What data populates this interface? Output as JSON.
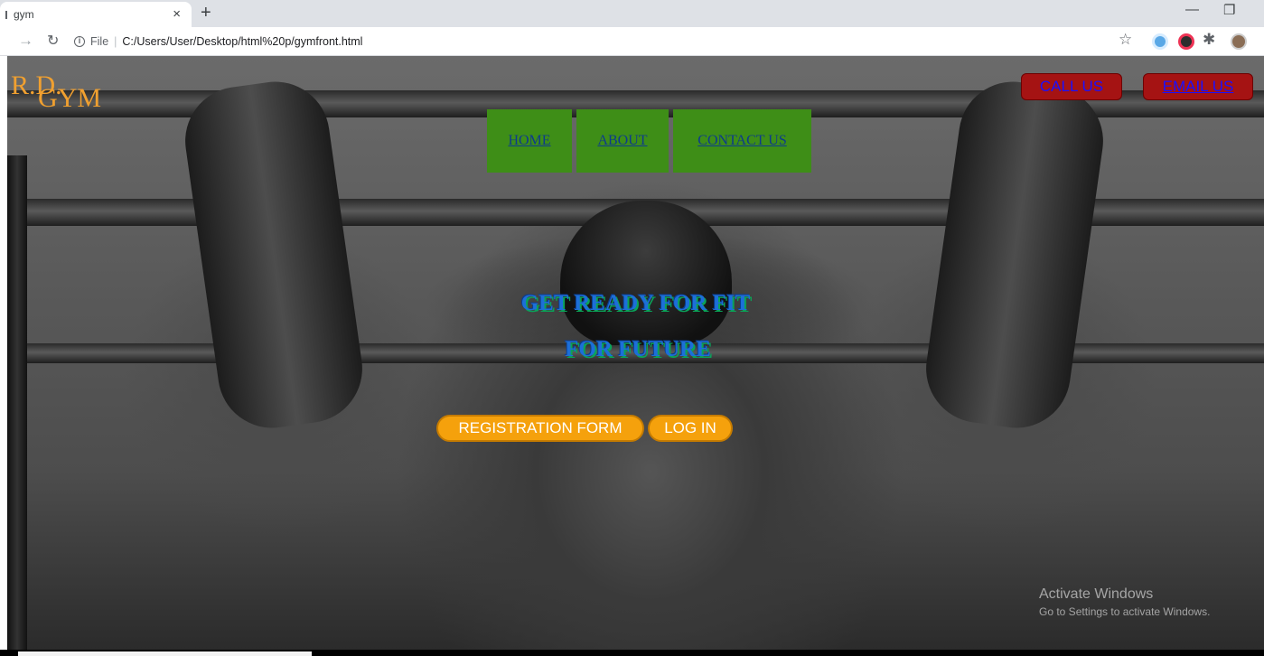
{
  "browser": {
    "tab_title": "gym",
    "url_scheme": "File",
    "url_path": "C:/Users/User/Desktop/html%20p/gymfront.html"
  },
  "logo": {
    "line1": "R.D.",
    "line2": "GYM",
    "color": "#f0a030"
  },
  "header_buttons": {
    "call": "CALL US",
    "email": "EMAIL US",
    "bg": "#a51313",
    "text_color": "#1a10ff"
  },
  "nav": {
    "items": [
      {
        "label": "HOME"
      },
      {
        "label": "ABOUT"
      },
      {
        "label": "CONTACT US"
      }
    ],
    "bg": "#3e8e17"
  },
  "hero": {
    "line1": "GET READY FOR FIT",
    "line2": "FOR FUTURE"
  },
  "actions": {
    "register": "REGISTRATION FORM",
    "login": "LOG IN",
    "bg": "#f5a10c"
  },
  "watermark": {
    "title": "Activate Windows",
    "subtitle": "Go to Settings to activate Windows."
  }
}
